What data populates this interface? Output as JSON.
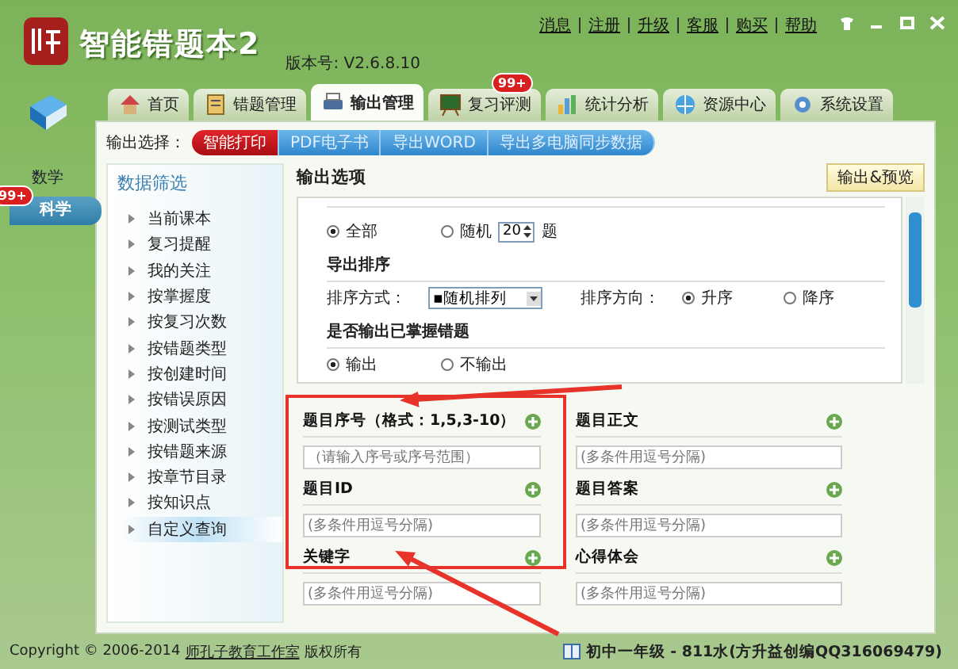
{
  "window": {
    "title": "智能错题本2",
    "version": "版本号: V2.6.8.10"
  },
  "top_links": [
    "消息",
    "注册",
    "升级",
    "客服",
    "购买",
    "帮助"
  ],
  "tabs": [
    {
      "label": "首页",
      "selected": false
    },
    {
      "label": "错题管理",
      "selected": false
    },
    {
      "label": "输出管理",
      "selected": true
    },
    {
      "label": "复习评测",
      "selected": false,
      "badge": "99+"
    },
    {
      "label": "统计分析",
      "selected": false
    },
    {
      "label": "资源中心",
      "selected": false
    },
    {
      "label": "系统设置",
      "selected": false
    }
  ],
  "subjects": [
    {
      "label": "数学",
      "selected": false
    },
    {
      "label": "科学",
      "selected": true,
      "badge": "99+"
    }
  ],
  "output_select": {
    "label": "输出选择：",
    "options": [
      {
        "label": "智能打印",
        "selected": true
      },
      {
        "label": "PDF电子书",
        "selected": false
      },
      {
        "label": "导出WORD",
        "selected": false
      },
      {
        "label": "导出多电脑同步数据",
        "selected": false
      }
    ]
  },
  "filter": {
    "title": "数据筛选",
    "items": [
      {
        "label": "当前课本",
        "selected": false
      },
      {
        "label": "复习提醒",
        "selected": false
      },
      {
        "label": "我的关注",
        "selected": false
      },
      {
        "label": "按掌握度",
        "selected": false
      },
      {
        "label": "按复习次数",
        "selected": false
      },
      {
        "label": "按错题类型",
        "selected": false
      },
      {
        "label": "按创建时间",
        "selected": false
      },
      {
        "label": "按错误原因",
        "selected": false
      },
      {
        "label": "按测试类型",
        "selected": false
      },
      {
        "label": "按错题来源",
        "selected": false
      },
      {
        "label": "按章节目录",
        "selected": false
      },
      {
        "label": "按知识点",
        "selected": false
      },
      {
        "label": "自定义查询",
        "selected": true
      }
    ]
  },
  "options": {
    "title": "输出选项",
    "preview_button": "输出&预览",
    "count": {
      "all": {
        "label": "全部",
        "selected": true
      },
      "random": {
        "label": "随机",
        "selected": false,
        "value": "20",
        "suffix": "题"
      }
    },
    "sort": {
      "title": "导出排序",
      "method_label": "排序方式：",
      "method_value": "▪随机排列",
      "direction_label": "排序方向：",
      "directions": [
        {
          "label": "升序",
          "selected": true
        },
        {
          "label": "降序",
          "selected": false
        }
      ]
    },
    "mastered": {
      "title": "是否输出已掌握错题",
      "choices": [
        {
          "label": "输出",
          "selected": true
        },
        {
          "label": "不输出",
          "selected": false
        }
      ]
    },
    "fields": [
      {
        "label": "题目序号（格式：1,5,3-10）",
        "placeholder": "（请输入序号或序号范围）"
      },
      {
        "label": "题目正文",
        "placeholder": "(多条件用逗号分隔)"
      },
      {
        "label": "题目ID",
        "placeholder": "(多条件用逗号分隔)"
      },
      {
        "label": "题目答案",
        "placeholder": "(多条件用逗号分隔)"
      },
      {
        "label": "关键字",
        "placeholder": "(多条件用逗号分隔)"
      },
      {
        "label": "心得体会",
        "placeholder": "(多条件用逗号分隔)"
      }
    ]
  },
  "status_bar": {
    "copyright": "Copyright © 2006-2014",
    "studio": "师孔子教育工作室",
    "rights": "版权所有",
    "grade": "初中一年级 - 811水(方升益创编QQ316069479)"
  }
}
